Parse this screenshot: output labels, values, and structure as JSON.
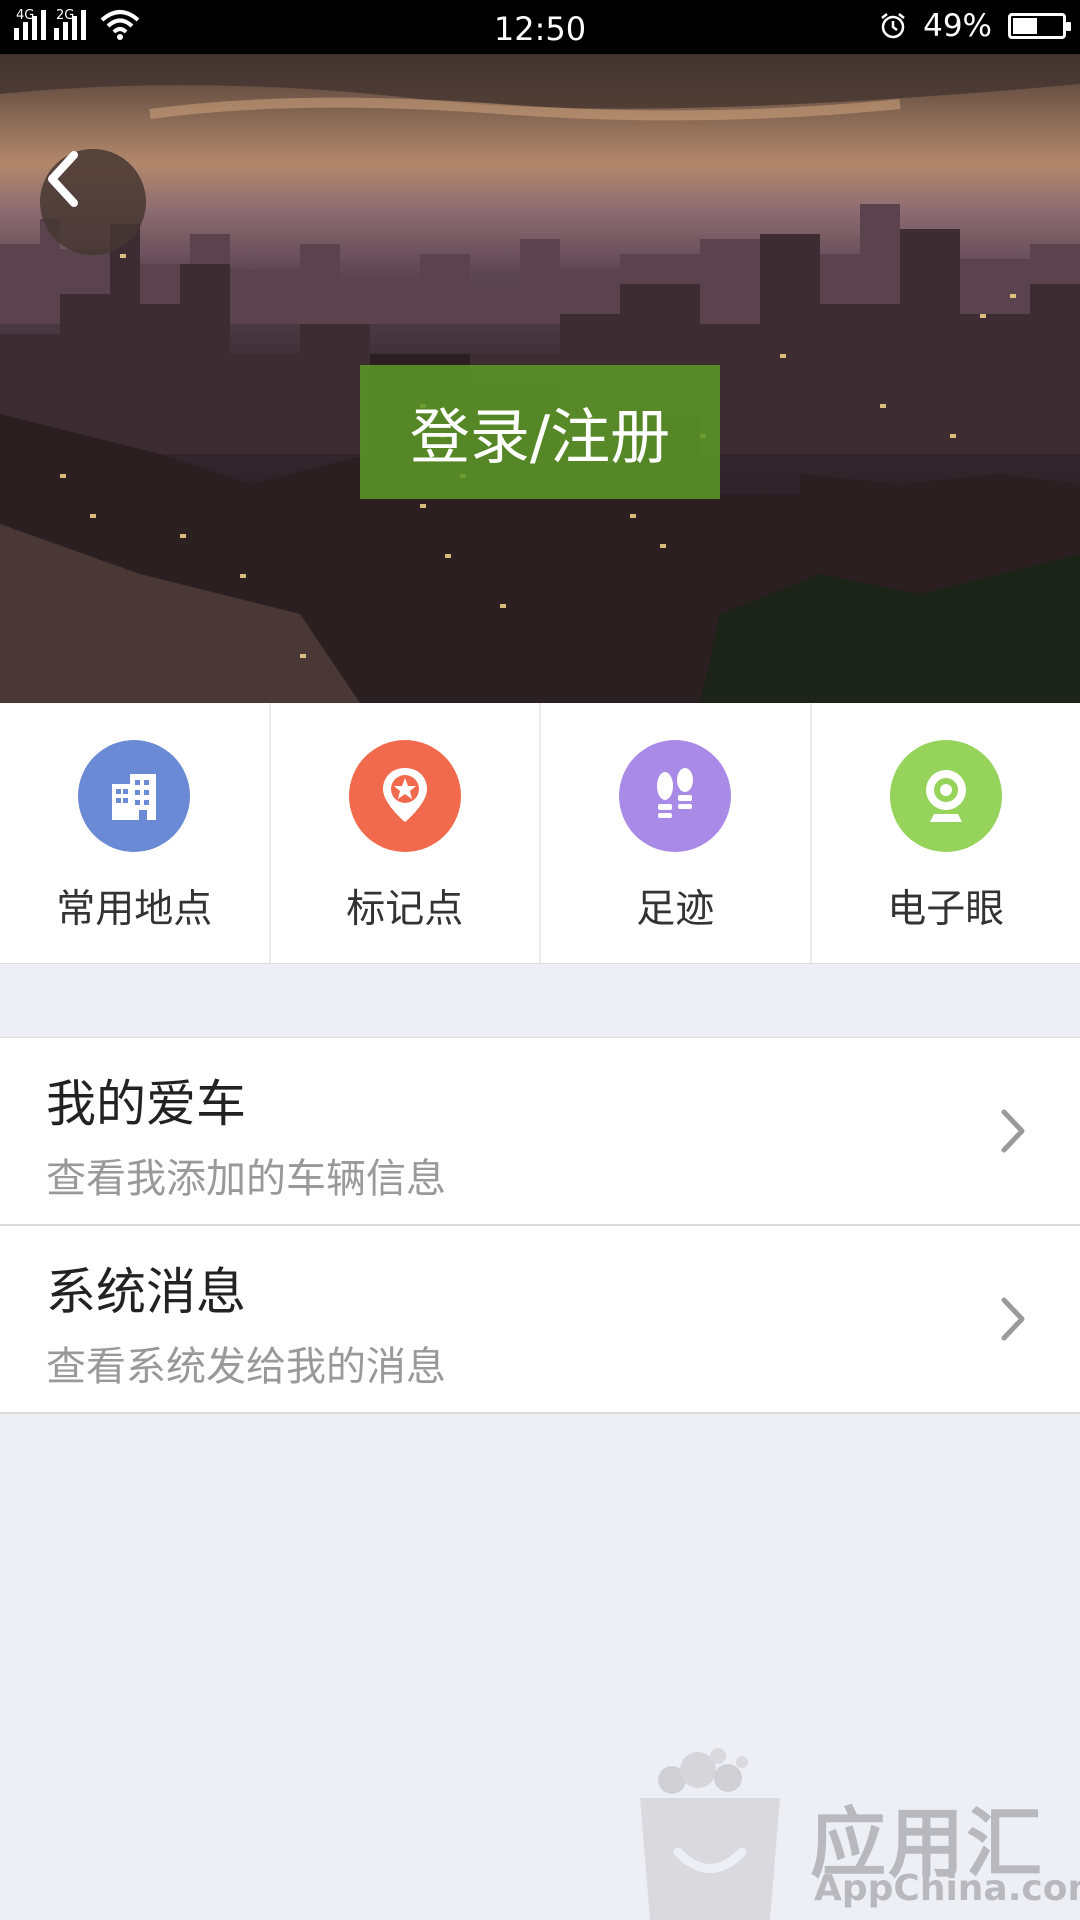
{
  "status_bar": {
    "signal1_label": "4G",
    "signal2_label": "2G",
    "time": "12:50",
    "battery_percent": "49%",
    "battery_level": 0.49
  },
  "hero": {
    "login_label": "登录/注册"
  },
  "shortcuts": [
    {
      "label": "常用地点",
      "icon": "building-icon",
      "color": "#6a8ad6"
    },
    {
      "label": "标记点",
      "icon": "pin-star-icon",
      "color": "#f26a4e"
    },
    {
      "label": "足迹",
      "icon": "footprints-icon",
      "color": "#a98ae6"
    },
    {
      "label": "电子眼",
      "icon": "webcam-icon",
      "color": "#95d35a"
    }
  ],
  "list": [
    {
      "title": "我的爱车",
      "subtitle": "查看我添加的车辆信息"
    },
    {
      "title": "系统消息",
      "subtitle": "查看系统发给我的消息"
    }
  ],
  "watermark": {
    "name_cn": "应用汇",
    "name_en": "AppChina.com"
  }
}
